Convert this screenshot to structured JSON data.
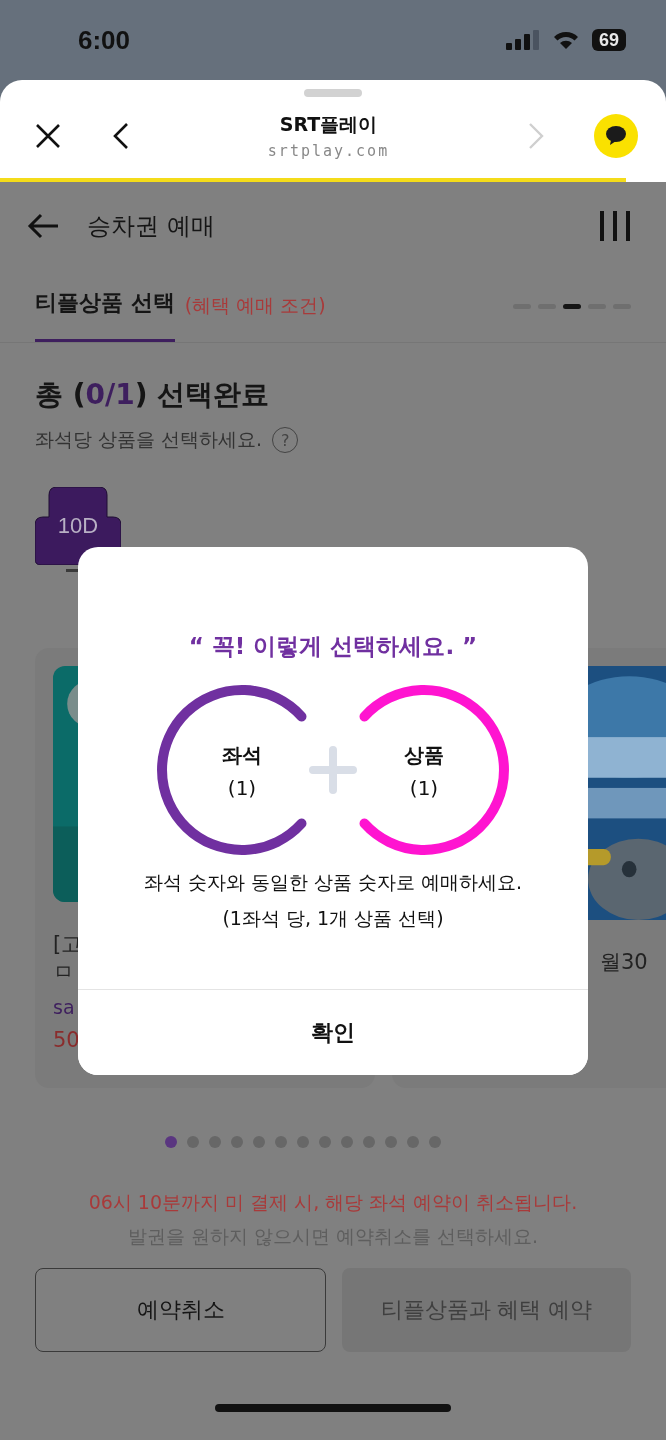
{
  "status_bar": {
    "time": "6:00",
    "battery": "69"
  },
  "browser": {
    "title": "SRT플레이",
    "url": "srtplay.com",
    "forward_disabled": true,
    "loading_bar": {
      "level": 0.94
    }
  },
  "app_header": {
    "title": "승차권 예매"
  },
  "tab": {
    "label": "티플상품 선택",
    "note": "(혜택 예매 조건)",
    "selected": true
  },
  "steps": [
    {
      "selected": false
    },
    {
      "selected": false
    },
    {
      "selected": true
    },
    {
      "selected": false
    },
    {
      "selected": false
    }
  ],
  "summary": {
    "prefix": "총 (",
    "count": "0/1",
    "suffix": ") 선택완료",
    "hint": "좌석당 상품을 선택하세요.",
    "help": "?"
  },
  "seats": [
    {
      "label": "10D",
      "selected": true
    }
  ],
  "cards": [
    {
      "lines": [
        "[고",
        "ㅁ"
      ],
      "brand": "sa",
      "price": "50"
    },
    {
      "lines": [
        "월30"
      ]
    }
  ],
  "pager": [
    {
      "selected": true
    },
    {
      "selected": false
    },
    {
      "selected": false
    },
    {
      "selected": false
    },
    {
      "selected": false
    },
    {
      "selected": false
    },
    {
      "selected": false
    },
    {
      "selected": false
    },
    {
      "selected": false
    },
    {
      "selected": false
    },
    {
      "selected": false
    },
    {
      "selected": false
    },
    {
      "selected": false
    }
  ],
  "notice": {
    "warning": "06시 10분까지 미 결제 시, 해당 좌석 예약이 취소됩니다.",
    "hint": "발권을 원하지 않으시면 예약취소를 선택하세요."
  },
  "buttons": [
    {
      "label": "예약취소",
      "disabled": false
    },
    {
      "label": "티플상품과 혜택 예약",
      "disabled": true
    }
  ],
  "modal": {
    "title": "“ 꼭! 이렇게 선택하세요. ”",
    "items": [
      {
        "label": "좌석",
        "count": "(1)",
        "color": "#7030a0"
      },
      {
        "label": "상품",
        "count": "(1)",
        "color": "#ff14d0"
      }
    ],
    "description": "좌석 숫자와 동일한 상품 숫자로 예매하세요.",
    "note": "(1좌석 당, 1개 상품 선택)",
    "confirm": "확인"
  }
}
